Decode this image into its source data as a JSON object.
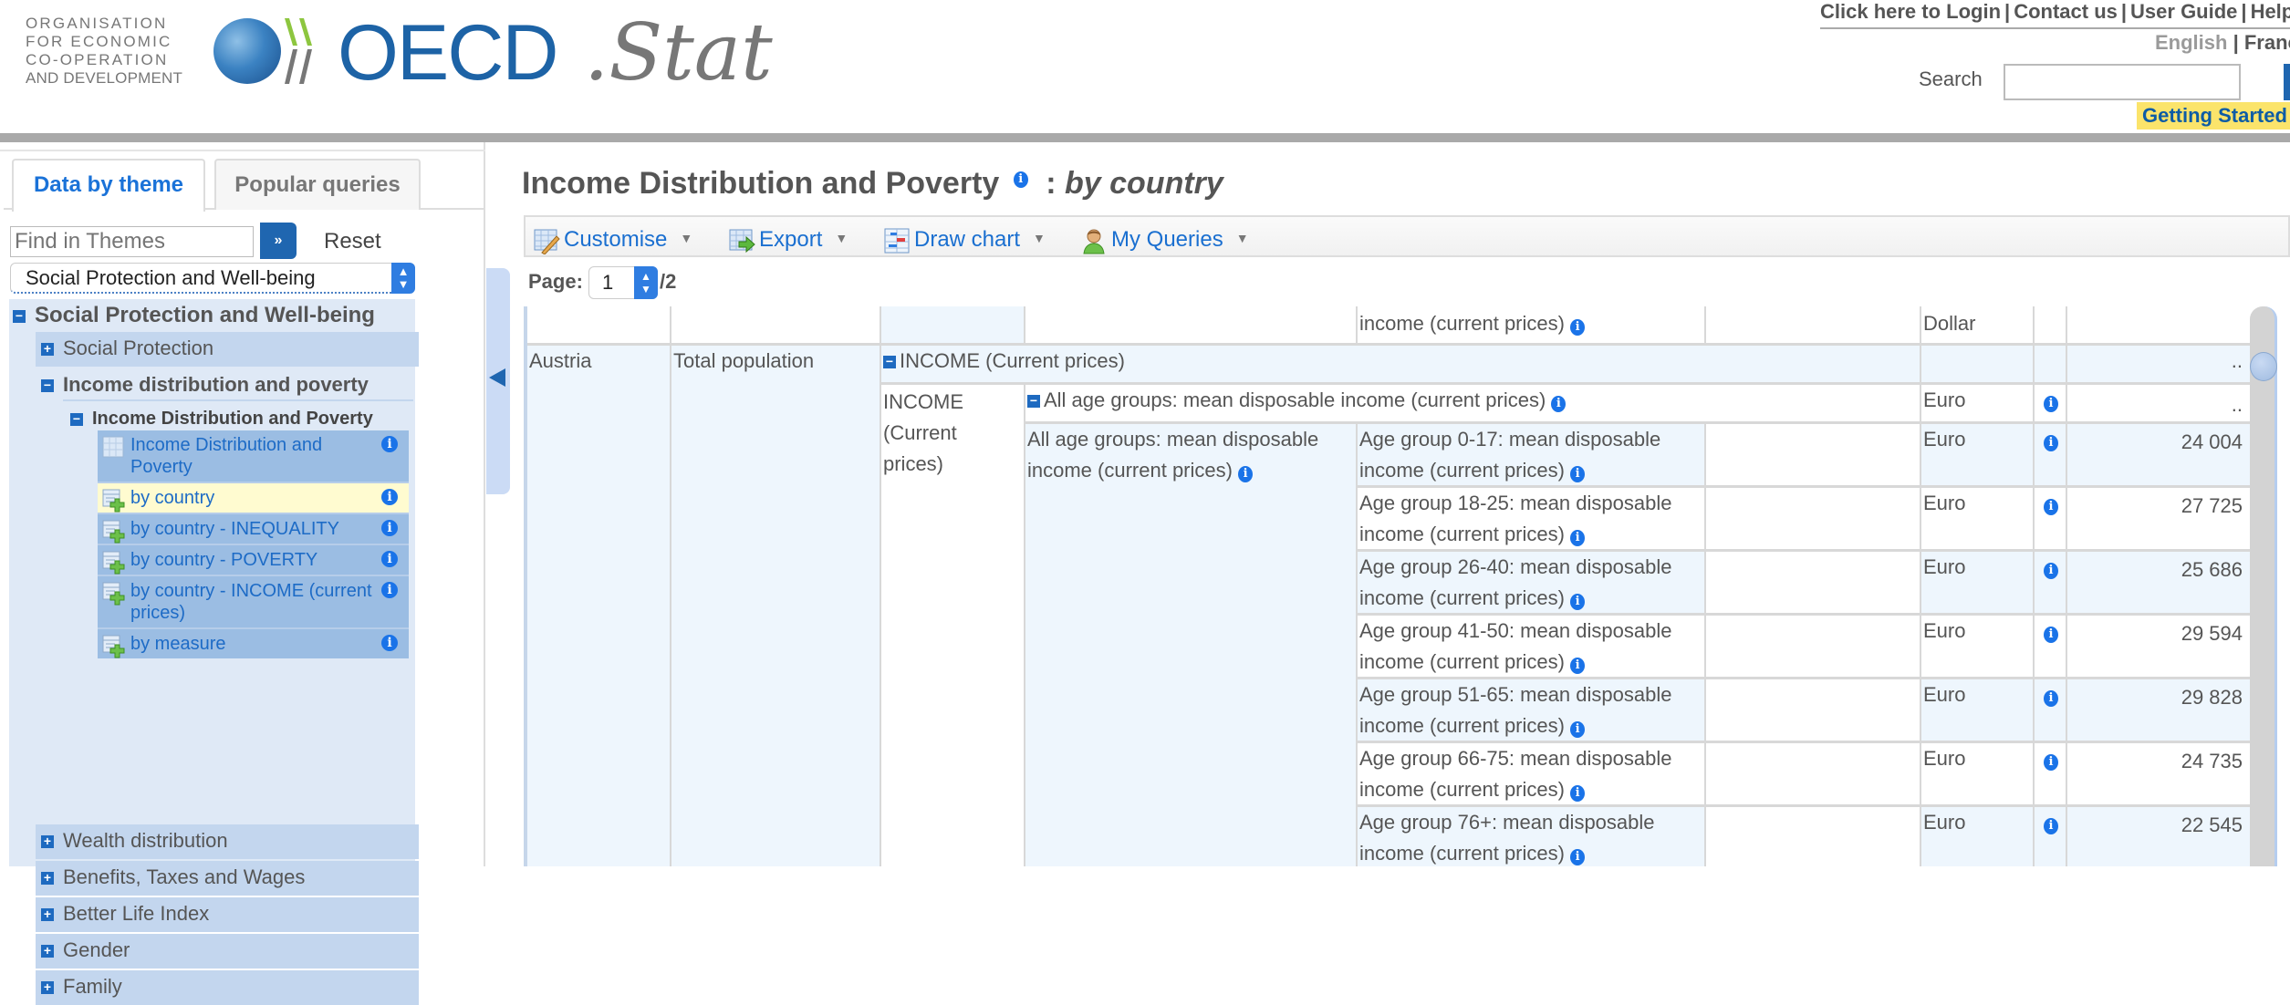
{
  "header": {
    "org_lines": [
      "ORGANISATION",
      "FOR ECONOMIC",
      "CO-OPERATION",
      "AND DEVELOPMENT"
    ],
    "logo_main": "OECD",
    "logo_suffix": ".Stat",
    "top_links": [
      "Click here to Login",
      "Contact us",
      "User Guide",
      "Help"
    ],
    "languages": [
      "English",
      "Français"
    ],
    "search_label": "Search",
    "search_value": "",
    "getting_started": "Getting Started",
    "colors": {
      "brand_blue": "#1d63a6",
      "getting_started_bg": "#fbe46b"
    }
  },
  "sidebar": {
    "tabs": [
      {
        "label": "Data by theme",
        "active": true
      },
      {
        "label": "Popular queries",
        "active": false
      }
    ],
    "find_placeholder": "Find in Themes",
    "find_go_icon": "double-chevron-right-icon",
    "find_go_glyph": "»",
    "reset_label": "Reset",
    "theme_selected": "Social Protection and Well-being",
    "tree": {
      "root": {
        "label": "Social Protection and Well-being",
        "expanded": true
      },
      "nodes": [
        {
          "label": "Social Protection",
          "expanded": false
        },
        {
          "label": "Income distribution and poverty",
          "expanded": true,
          "children": [
            {
              "label": "Income Distribution and Poverty",
              "expanded": true,
              "leaves": [
                {
                  "label": "Income Distribution and Poverty",
                  "icon": "table-icon",
                  "selected": false
                },
                {
                  "label": "by country",
                  "icon": "query-icon",
                  "selected": true
                },
                {
                  "label": "by country - INEQUALITY",
                  "icon": "query-icon",
                  "selected": false
                },
                {
                  "label": "by country - POVERTY",
                  "icon": "query-icon",
                  "selected": false
                },
                {
                  "label": "by country - INCOME (current prices)",
                  "icon": "query-icon",
                  "selected": false
                },
                {
                  "label": "by measure",
                  "icon": "query-icon",
                  "selected": false
                }
              ]
            }
          ]
        },
        {
          "label": "Wealth distribution",
          "expanded": false
        },
        {
          "label": "Benefits, Taxes and Wages",
          "expanded": false
        },
        {
          "label": "Better Life Index",
          "expanded": false
        },
        {
          "label": "Gender",
          "expanded": false
        },
        {
          "label": "Family",
          "expanded": false
        }
      ],
      "plus_glyph": "+",
      "minus_glyph": "−"
    }
  },
  "main": {
    "title": "Income Distribution and Poverty",
    "title_separator": ":",
    "subtitle": "by country",
    "info_glyph": "i",
    "toolbar": [
      {
        "label": "Customise",
        "icon": "customise-icon"
      },
      {
        "label": "Export",
        "icon": "export-icon"
      },
      {
        "label": "Draw chart",
        "icon": "chart-icon"
      },
      {
        "label": "My Queries",
        "icon": "user-icon"
      }
    ],
    "dropdown_glyph": "▼",
    "pager": {
      "label": "Page:",
      "current": "1",
      "total": "/2"
    }
  },
  "table": {
    "top_partial": {
      "measure_tail": "income (current prices)",
      "unit": "Dollar"
    },
    "country": "Austria",
    "population": "Total population",
    "group_header": "INCOME (Current prices)",
    "group_label": "INCOME (Current prices)",
    "subgroup_header": "All age groups: mean disposable income (current prices)",
    "subgroup_label": "All age groups: mean disposable income (current prices)",
    "group_value": "..",
    "subgroup_unit": "Euro",
    "subgroup_value": "..",
    "rows": [
      {
        "measure": "Age group 0-17: mean disposable income (current prices)",
        "unit": "Euro",
        "value": "24 004"
      },
      {
        "measure": "Age group 18-25: mean disposable income (current prices)",
        "unit": "Euro",
        "value": "27 725"
      },
      {
        "measure": "Age group 26-40: mean disposable income (current prices)",
        "unit": "Euro",
        "value": "25 686"
      },
      {
        "measure": "Age group 41-50: mean disposable income (current prices)",
        "unit": "Euro",
        "value": "29 594"
      },
      {
        "measure": "Age group 51-65: mean disposable income (current prices)",
        "unit": "Euro",
        "value": "29 828"
      },
      {
        "measure": "Age group 66-75: mean disposable income (current prices)",
        "unit": "Euro",
        "value": "24 735"
      },
      {
        "measure": "Age group 76+: mean disposable income (current prices)",
        "unit": "Euro",
        "value": "22 545"
      }
    ]
  }
}
